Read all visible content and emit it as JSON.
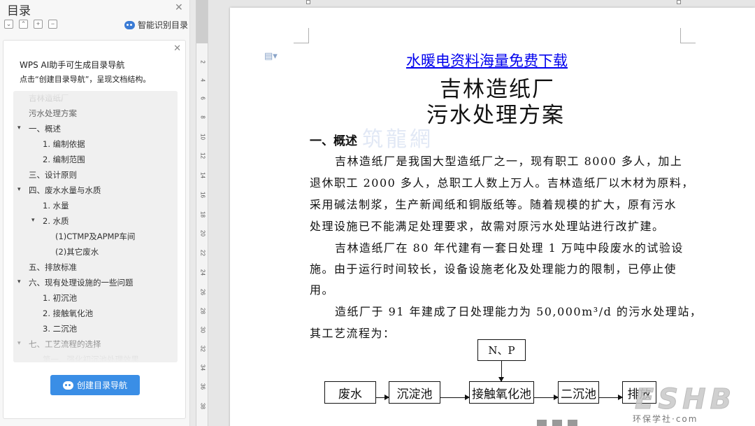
{
  "toc": {
    "title": "目录",
    "close": "✕",
    "tools": [
      "⌄",
      "⌃",
      "+",
      "−"
    ],
    "smart_label": "智能识别目录",
    "ai_box": {
      "close": "✕",
      "line1": "WPS AI助手可生成目录导航",
      "line2": "点击“创建目录导航”，呈现文档结构。"
    },
    "items": [
      "吉林造纸厂",
      "污水处理方案",
      "一、概述",
      "1. 编制依据",
      "2. 编制范围",
      "三、设计原则",
      "四、废水水量与水质",
      "1. 水量",
      "2. 水质",
      "(1)CTMP及APMP车间",
      "(2)其它废水",
      "五、排放标准",
      "六、现有处理设施的一些问题",
      "1. 初沉池",
      "2. 接触氧化池",
      "3. 二沉池",
      "七、工艺流程的选择",
      "第一、强化初沉池处理效果"
    ],
    "create_button": "创建目录导航"
  },
  "ruler": {
    "numbers": [
      "2",
      "4",
      "6",
      "8",
      "10",
      "12",
      "14",
      "16",
      "18",
      "20",
      "22",
      "24",
      "26",
      "28",
      "30",
      "32",
      "34",
      "36",
      "38"
    ]
  },
  "doc": {
    "link_title": "水暖电资料海量免费下载",
    "title1": "吉林造纸厂",
    "title2": "污水处理方案",
    "watermark": "筑龍網",
    "section1": "一、概述",
    "lines": [
      "吉林造纸厂是我国大型造纸厂之一，现有职工 8000 多人，加上",
      "退休职工 2000 多人，总职工人数上万人。吉林造纸厂以木材为原料，",
      "采用碱法制浆，生产新闻纸和铜版纸等。随着规模的扩大，原有污水",
      "处理设施已不能满足处理要求，故需对原污水处理站进行改扩建。",
      "吉林造纸厂在 80 年代建有一套日处理 1 万吨中段废水的试验设",
      "施。由于运行时间较长，设备设施老化及处理能力的限制，已停止使",
      "用。",
      "造纸厂于 91 年建成了日处理能力为 50,000m³/d 的污水处理站，",
      "其工艺流程为："
    ],
    "flow": {
      "top": "N、P",
      "boxes": [
        "废水",
        "沉淀池",
        "接触氧化池",
        "二沉池",
        "排放"
      ]
    }
  },
  "brand": {
    "logo": "ESHB",
    "sub": "环保学社·com"
  }
}
